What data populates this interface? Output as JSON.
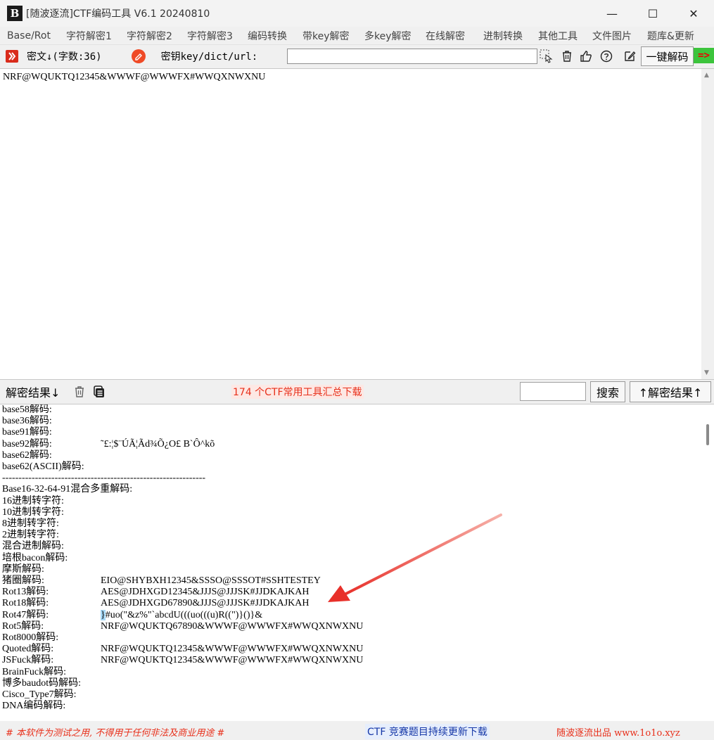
{
  "window": {
    "logo_text": "B",
    "title": "[随波逐流]CTF编码工具 V6.1 20240810",
    "minimize": "—",
    "maximize": "☐",
    "close": "✕"
  },
  "menu": [
    "Base/Rot",
    "字符解密1",
    "字符解密2",
    "字符解密3",
    "编码转换",
    "带key解密",
    "多key解密",
    "在线解密",
    "进制转换",
    "其他工具",
    "文件图片",
    "题库&更新"
  ],
  "toolbar": {
    "cipher_label": "密文↓(字数:36)",
    "key_label": "密钥key/dict/url:",
    "key_value": "",
    "decode_button": "一键解码",
    "go_arrow": "=>"
  },
  "cipher_text": "NRF@WQUKTQ12345&WWWF@WWWFX#WWQXNWXNU",
  "results_toolbar": {
    "label": "解密结果↓",
    "promo": "174 个CTF常用工具汇总下载",
    "search_value": "",
    "search_button": "搜索",
    "up_results_button": "↑解密结果↑"
  },
  "results": [
    {
      "label": "base58解码:",
      "value": ""
    },
    {
      "label": "base36解码:",
      "value": ""
    },
    {
      "label": "base91解码:",
      "value": ""
    },
    {
      "label": "base92解码:",
      "value": "˜£:¦$¨ÚÃ¦Ãd¾Õ¿O£ B`Ô^kõ"
    },
    {
      "label": "base62解码:",
      "value": ""
    },
    {
      "label": "base62(ASCII)解码:",
      "value": ""
    },
    {
      "label": "--------------------------------------------------------------",
      "value": ""
    },
    {
      "label": "Base16-32-64-91混合多重解码:",
      "value": ""
    },
    {
      "label": "",
      "value": ""
    },
    {
      "label": "16进制转字符:",
      "value": ""
    },
    {
      "label": "10进制转字符:",
      "value": ""
    },
    {
      "label": "8进制转字符:",
      "value": ""
    },
    {
      "label": "2进制转字符:",
      "value": ""
    },
    {
      "label": "混合进制解码:",
      "value": ""
    },
    {
      "label": "培根bacon解码:",
      "value": ""
    },
    {
      "label": "摩斯解码:",
      "value": ""
    },
    {
      "label": "猪圈解码:",
      "value": "EIO@SHYBXH12345&SSSO@SSSOT#SSHTESTEY"
    },
    {
      "label": "Rot13解码:",
      "value": "AES@JDHXGD12345&JJJS@JJJSK#JJDKAJKAH"
    },
    {
      "label": "Rot18解码:",
      "value": "AES@JDHXGD67890&JJJS@JJJSK#JJDKAJKAH"
    },
    {
      "label": "Rot47解码:",
      "value": "}#uo(\"&z%\"`abcdU(((uo(((u)R((\")}()}&",
      "highlight": "}"
    },
    {
      "label": "Rot5解码:",
      "value": "NRF@WQUKTQ67890&WWWF@WWWFX#WWQXNWXNU"
    },
    {
      "label": "Rot8000解码:",
      "value": ""
    },
    {
      "label": "Quoted解码:",
      "value": "NRF@WQUKTQ12345&WWWF@WWWFX#WWQXNWXNU"
    },
    {
      "label": "JSFuck解码:",
      "value": "NRF@WQUKTQ12345&WWWF@WWWFX#WWQXNWXNU"
    },
    {
      "label": "BrainFuck解码:",
      "value": ""
    },
    {
      "label": "博多baudot码解码:",
      "value": ""
    },
    {
      "label": "Cisco_Type7解码:",
      "value": ""
    },
    {
      "label": "DNA编码解码:",
      "value": ""
    }
  ],
  "status": {
    "left": "# 本软件为测试之用, 不得用于任何非法及商业用途 #",
    "middle": "CTF 竞赛题目持续更新下载",
    "right": "随波逐流出品 www.1o1o.xyz"
  },
  "colors": {
    "warning_red": "#e8301b",
    "link_blue": "#1537a7",
    "highlight": "#a7d8f5",
    "go_green": "#3cc43c"
  }
}
